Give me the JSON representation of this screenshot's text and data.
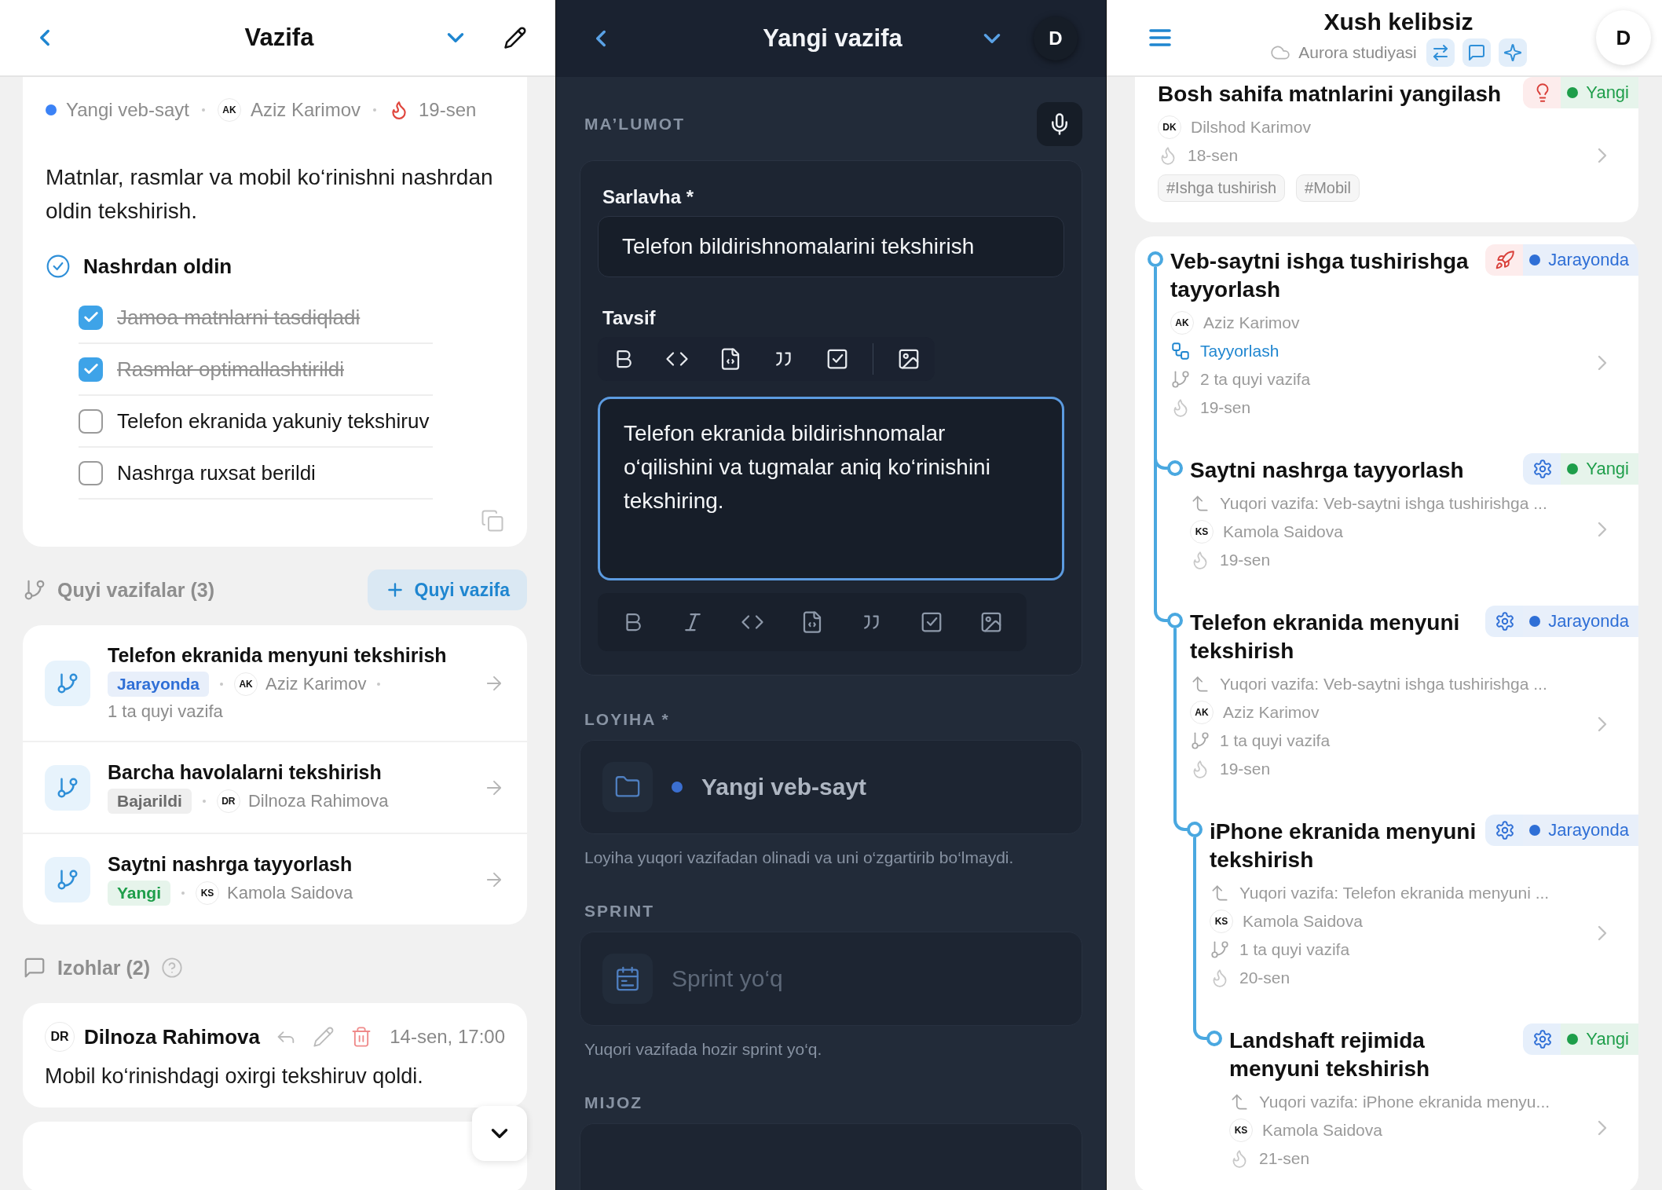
{
  "left": {
    "header": {
      "title": "Vazifa"
    },
    "meta": {
      "project": {
        "name": "Yangi veb-sayt",
        "color": "#3b82f6"
      },
      "assignee": {
        "initials": "AK",
        "name": "Aziz Karimov"
      },
      "due": "19-sen"
    },
    "description": "Matnlar, rasmlar va mobil ko‘rinishni nashrdan oldin tekshirish.",
    "checklist": {
      "title": "Nashrdan oldin",
      "items": [
        {
          "label": "Jamoa matnlarni tasdiqladi",
          "checked": true
        },
        {
          "label": "Rasmlar optimallashtirildi",
          "checked": true
        },
        {
          "label": "Telefon ekranida yakuniy tekshiruv",
          "checked": false
        },
        {
          "label": "Nashrga ruxsat berildi",
          "checked": false
        }
      ]
    },
    "subtasks": {
      "title": "Quyi vazifalar (3)",
      "add_button": "Quyi vazifa",
      "items": [
        {
          "title": "Telefon ekranida menyuni tekshirish",
          "status": {
            "label": "Jarayonda",
            "color": "#2f6fd6"
          },
          "assignee": {
            "initials": "AK",
            "name": "Aziz Karimov"
          },
          "subtasks": "1 ta quyi vazifa"
        },
        {
          "title": "Barcha havolalarni tekshirish",
          "status": {
            "label": "Bajarildi",
            "color": "#6b6b6b"
          },
          "assignee": {
            "initials": "DR",
            "name": "Dilnoza Rahimova"
          }
        },
        {
          "title": "Saytni nashrga tayyorlash",
          "status": {
            "label": "Yangi",
            "color": "#1e9e4a"
          },
          "assignee": {
            "initials": "KS",
            "name": "Kamola Saidova"
          }
        }
      ]
    },
    "comments": {
      "title": "Izohlar (2)",
      "items": [
        {
          "initials": "DR",
          "author": "Dilnoza Rahimova",
          "time": "14-sen, 17:00",
          "text": "Mobil ko‘rinishdagi oxirgi tekshiruv qoldi."
        }
      ]
    }
  },
  "middle": {
    "header": {
      "title": "Yangi vazifa",
      "avatar": "D"
    },
    "section": "MA’LUMOT",
    "title_field": {
      "label": "Sarlavha *",
      "value": "Telefon bildirishnomalarini tekshirish",
      "focused": false
    },
    "description_field": {
      "label": "Tavsif",
      "value": "Telefon ekranida bildirishnomalar o‘qilishini va tugmalar aniq ko‘rinishini tekshiring.",
      "focused": true
    },
    "toolbar_top": [
      {
        "kind": "bold"
      },
      {
        "kind": "code"
      },
      {
        "kind": "code-file"
      },
      {
        "kind": "quote"
      },
      {
        "kind": "task"
      },
      {
        "kind": "separator"
      },
      {
        "kind": "image"
      }
    ],
    "toolbar_bottom": [
      {
        "kind": "bold"
      },
      {
        "kind": "italic"
      },
      {
        "kind": "code"
      },
      {
        "kind": "code-file"
      },
      {
        "kind": "quote"
      },
      {
        "kind": "task"
      },
      {
        "kind": "image"
      }
    ],
    "project": {
      "label": "LOYIHA *",
      "value": "Yangi veb-sayt",
      "color": "#3b6fd0",
      "disabled": true,
      "hint": "Loyiha yuqori vazifadan olinadi va uni o‘zgartirib bo‘lmaydi."
    },
    "sprint": {
      "label": "SPRINT",
      "placeholder": "Sprint yo‘q",
      "hint": "Yuqori vazifada hozir sprint yo‘q."
    },
    "client": {
      "label": "MIJOZ"
    }
  },
  "right": {
    "header": {
      "title": "Xush kelibsiz",
      "workspace": "Aurora studiyasi",
      "avatar": "D"
    },
    "tasks": [
      {
        "title": "Bosh sahifa matnlarini yangilash",
        "kind": "idea",
        "status": {
          "label": "Yangi",
          "color": "#1e9e4a"
        },
        "meta": [
          {
            "kind": "assignee",
            "initials": "DK",
            "text": "Dilshod Karimov"
          },
          {
            "kind": "due",
            "text": "18-sen"
          }
        ],
        "tags": [
          "#Ishga tushirish",
          "#Mobil"
        ]
      },
      {
        "title": "Veb-saytni ishga tushirishga tayyorlash",
        "kind": "release",
        "status": {
          "label": "Jarayonda",
          "color": "#2f6fd6"
        },
        "meta": [
          {
            "kind": "assignee",
            "initials": "AK",
            "text": "Aziz Karimov"
          },
          {
            "kind": "stage",
            "text": "Tayyorlash"
          },
          {
            "kind": "subtasks",
            "text": "2 ta quyi vazifa"
          },
          {
            "kind": "due",
            "text": "19-sen"
          }
        ],
        "children": [
          {
            "title": "Saytni nashrga tayyorlash",
            "kind": "task",
            "status": {
              "label": "Yangi",
              "color": "#1e9e4a"
            },
            "meta": [
              {
                "kind": "parent",
                "text": "Yuqori vazifa: Veb-saytni ishga tushirishga ..."
              },
              {
                "kind": "assignee",
                "initials": "KS",
                "text": "Kamola Saidova"
              },
              {
                "kind": "due",
                "text": "19-sen"
              }
            ]
          },
          {
            "title": "Telefon ekranida menyuni tekshirish",
            "kind": "task",
            "status": {
              "label": "Jarayonda",
              "color": "#2f6fd6"
            },
            "meta": [
              {
                "kind": "parent",
                "text": "Yuqori vazifa: Veb-saytni ishga tushirishga ..."
              },
              {
                "kind": "assignee",
                "initials": "AK",
                "text": "Aziz Karimov"
              },
              {
                "kind": "subtasks",
                "text": "1 ta quyi vazifa"
              },
              {
                "kind": "due",
                "text": "19-sen"
              }
            ],
            "children": [
              {
                "title": "iPhone ekranida menyuni tekshirish",
                "kind": "task",
                "status": {
                  "label": "Jarayonda",
                  "color": "#2f6fd6"
                },
                "meta": [
                  {
                    "kind": "parent",
                    "text": "Yuqori vazifa: Telefon ekranida menyuni ..."
                  },
                  {
                    "kind": "assignee",
                    "initials": "KS",
                    "text": "Kamola Saidova"
                  },
                  {
                    "kind": "subtasks",
                    "text": "1 ta quyi vazifa"
                  },
                  {
                    "kind": "due",
                    "text": "20-sen"
                  }
                ],
                "children": [
                  {
                    "title": "Landshaft rejimida menyuni tekshirish",
                    "kind": "task",
                    "status": {
                      "label": "Yangi",
                      "color": "#1e9e4a"
                    },
                    "meta": [
                      {
                        "kind": "parent",
                        "text": "Yuqori vazifa: iPhone ekranida menyu..."
                      },
                      {
                        "kind": "assignee",
                        "initials": "KS",
                        "text": "Kamola Saidova"
                      },
                      {
                        "kind": "due",
                        "text": "21-sen"
                      }
                    ]
                  }
                ]
              }
            ]
          }
        ]
      }
    ]
  }
}
